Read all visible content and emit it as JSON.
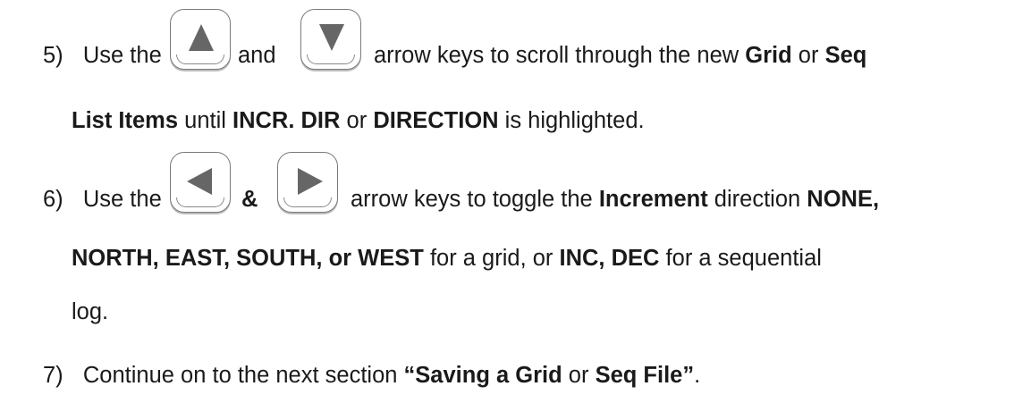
{
  "step5": {
    "num": "5)",
    "use_the": "Use the",
    "and": "and",
    "rest1": "arrow keys to scroll through the new",
    "grid": "Grid",
    "or1": "or",
    "seq": "Seq",
    "list_items": "List Items",
    "until": "until",
    "incr_dir": "INCR. DIR",
    "or2": "or",
    "direction": "DIRECTION",
    "is_highlighted": "is highlighted."
  },
  "step6": {
    "num": "6)",
    "use_the": "Use the",
    "amp": "&",
    "rest1": "arrow keys to toggle the",
    "increment": "Increment",
    "direction_word": "direction",
    "none": "NONE,",
    "dirs": "NORTH, EAST, SOUTH, or WEST",
    "for_grid": "for a grid, or",
    "inc_dec": "INC, DEC",
    "for_seq": "for a sequential",
    "log": "log."
  },
  "step7": {
    "num": "7)",
    "text": "Continue on to the next section",
    "saving": "“Saving a Grid",
    "or": "or",
    "seq_file": "Seq File”",
    "period": "."
  },
  "icons": {
    "up": "up-arrow-key",
    "down": "down-arrow-key",
    "left": "left-arrow-key",
    "right": "right-arrow-key"
  }
}
